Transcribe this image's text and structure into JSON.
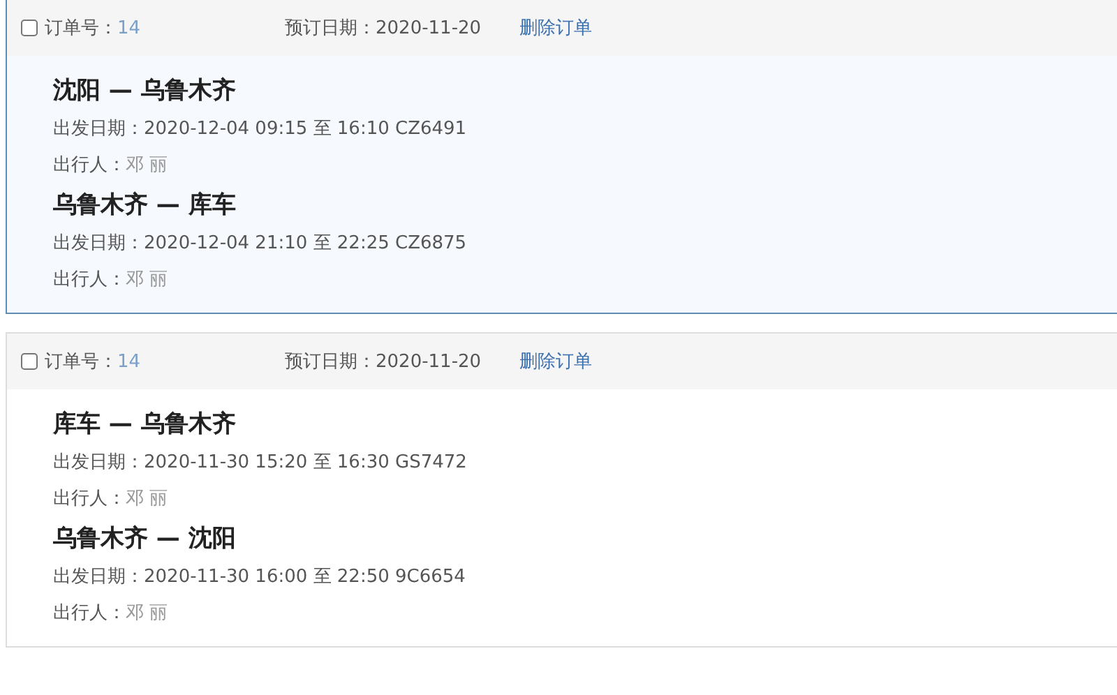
{
  "orders": [
    {
      "checked": false,
      "selected": true,
      "order_label": "订单号：",
      "order_no": "14",
      "booking_date": "预订日期：2020-11-20",
      "delete_link": "删除订单",
      "flights": [
        {
          "route": "沈阳 — 乌鲁木齐",
          "departure": "出发日期：2020-12-04 09:15 至 16:10 CZ6491",
          "passenger_label": "出行人：",
          "passenger": "邓 丽"
        },
        {
          "route": "乌鲁木齐 — 库车",
          "departure": "出发日期：2020-12-04 21:10 至 22:25 CZ6875",
          "passenger_label": "出行人：",
          "passenger": "邓 丽"
        }
      ]
    },
    {
      "checked": false,
      "selected": false,
      "order_label": "订单号：",
      "order_no": "14",
      "booking_date": "预订日期：2020-11-20",
      "delete_link": "删除订单",
      "flights": [
        {
          "route": "库车 — 乌鲁木齐",
          "departure": "出发日期：2020-11-30 15:20 至 16:30 GS7472",
          "passenger_label": "出行人：",
          "passenger": "邓 丽"
        },
        {
          "route": "乌鲁木齐 — 沈阳",
          "departure": "出发日期：2020-11-30 16:00 至 22:50 9C6654",
          "passenger_label": "出行人：",
          "passenger": "邓 丽"
        }
      ]
    }
  ]
}
